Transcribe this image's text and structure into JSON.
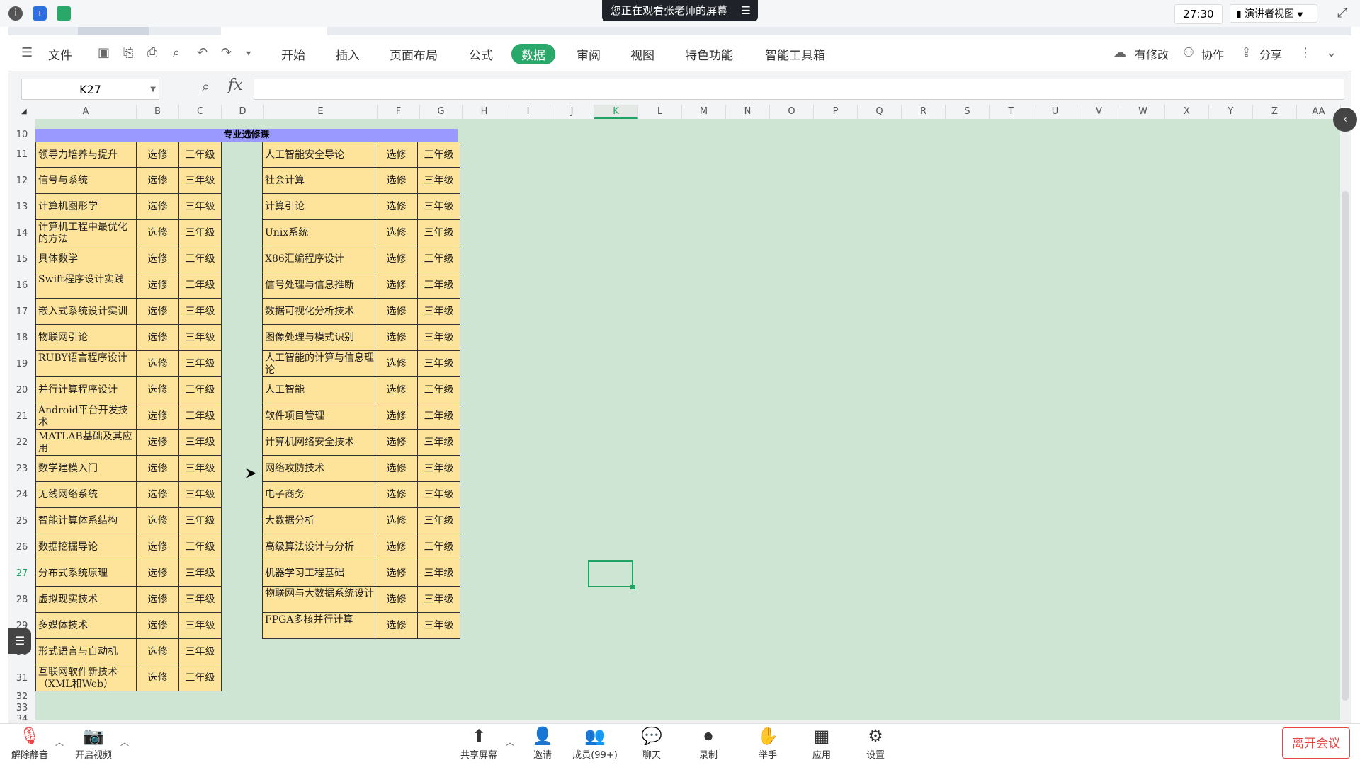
{
  "meeting": {
    "banner": "您正在观看张老师的屏幕",
    "time": "27:30",
    "view_mode": "演讲者视图",
    "leave": "离开会议",
    "toolbar": [
      {
        "label": "解除静音",
        "icon": "mic-muted-icon"
      },
      {
        "label": "开启视频",
        "icon": "camera-off-icon"
      },
      {
        "label": "共享屏幕",
        "icon": "share-screen-icon"
      },
      {
        "label": "邀请",
        "icon": "invite-icon"
      },
      {
        "label": "成员(99+)",
        "icon": "members-icon"
      },
      {
        "label": "聊天",
        "icon": "chat-icon"
      },
      {
        "label": "录制",
        "icon": "record-icon"
      },
      {
        "label": "举手",
        "icon": "raise-hand-icon"
      },
      {
        "label": "应用",
        "icon": "apps-icon"
      },
      {
        "label": "设置",
        "icon": "settings-icon"
      }
    ]
  },
  "ribbon": {
    "file": "文件",
    "tabs": [
      "开始",
      "插入",
      "页面布局",
      "公式",
      "数据",
      "审阅",
      "视图",
      "特色功能",
      "智能工具箱"
    ],
    "active_tab": "数据",
    "modified": "有修改",
    "collab": "协作",
    "share": "分享"
  },
  "formula_bar": {
    "cell_ref": "K27",
    "fx": "fx",
    "value": ""
  },
  "columns": [
    "A",
    "B",
    "C",
    "D",
    "E",
    "F",
    "G",
    "H",
    "I",
    "J",
    "K",
    "L",
    "M",
    "N",
    "O",
    "P",
    "Q",
    "R",
    "S",
    "T",
    "U",
    "V",
    "W",
    "X",
    "Y",
    "Z",
    "AA"
  ],
  "rows": [
    "10",
    "11",
    "12",
    "13",
    "14",
    "15",
    "16",
    "17",
    "18",
    "19",
    "20",
    "21",
    "22",
    "23",
    "24",
    "25",
    "26",
    "27",
    "28",
    "29",
    "30",
    "31",
    "32",
    "33",
    "34"
  ],
  "sheet": {
    "title": "专业选修课",
    "left_table": [
      [
        "领导力培养与提升",
        "选修",
        "三年级"
      ],
      [
        "信号与系统",
        "选修",
        "三年级"
      ],
      [
        "计算机图形学",
        "选修",
        "三年级"
      ],
      [
        "计算机工程中最优化的方法",
        "选修",
        "三年级"
      ],
      [
        "具体数学",
        "选修",
        "三年级"
      ],
      [
        "Swift程序设计实践",
        "选修",
        "三年级"
      ],
      [
        "嵌入式系统设计实训",
        "选修",
        "三年级"
      ],
      [
        "物联网引论",
        "选修",
        "三年级"
      ],
      [
        "RUBY语言程序设计",
        "选修",
        "三年级"
      ],
      [
        "并行计算程序设计",
        "选修",
        "三年级"
      ],
      [
        "Android平台开发技术",
        "选修",
        "三年级"
      ],
      [
        "MATLAB基础及其应用",
        "选修",
        "三年级"
      ],
      [
        "数学建模入门",
        "选修",
        "三年级"
      ],
      [
        "无线网络系统",
        "选修",
        "三年级"
      ],
      [
        "智能计算体系结构",
        "选修",
        "三年级"
      ],
      [
        "数据挖掘导论",
        "选修",
        "三年级"
      ],
      [
        "分布式系统原理",
        "选修",
        "三年级"
      ],
      [
        "虚拟现实技术",
        "选修",
        "三年级"
      ],
      [
        "多媒体技术",
        "选修",
        "三年级"
      ],
      [
        "形式语言与自动机",
        "选修",
        "三年级"
      ],
      [
        "互联网软件新技术（XML和Web）",
        "选修",
        "三年级"
      ]
    ],
    "right_table": [
      [
        "人工智能安全导论",
        "选修",
        "三年级"
      ],
      [
        "社会计算",
        "选修",
        "三年级"
      ],
      [
        "计算引论",
        "选修",
        "三年级"
      ],
      [
        "Unix系统",
        "选修",
        "三年级"
      ],
      [
        "X86汇编程序设计",
        "选修",
        "三年级"
      ],
      [
        "信号处理与信息推断",
        "选修",
        "三年级"
      ],
      [
        "数据可视化分析技术",
        "选修",
        "三年级"
      ],
      [
        "图像处理与模式识别",
        "选修",
        "三年级"
      ],
      [
        "人工智能的计算与信息理论",
        "选修",
        "三年级"
      ],
      [
        "人工智能",
        "选修",
        "三年级"
      ],
      [
        "软件项目管理",
        "选修",
        "三年级"
      ],
      [
        "计算机网络安全技术",
        "选修",
        "三年级"
      ],
      [
        "网络攻防技术",
        "选修",
        "三年级"
      ],
      [
        "电子商务",
        "选修",
        "三年级"
      ],
      [
        "大数据分析",
        "选修",
        "三年级"
      ],
      [
        "高级算法设计与分析",
        "选修",
        "三年级"
      ],
      [
        "机器学习工程基础",
        "选修",
        "三年级"
      ],
      [
        "物联网与大数据系统设计",
        "选修",
        "三年级"
      ],
      [
        "FPGA多核并行计算",
        "选修",
        "三年级"
      ]
    ]
  }
}
